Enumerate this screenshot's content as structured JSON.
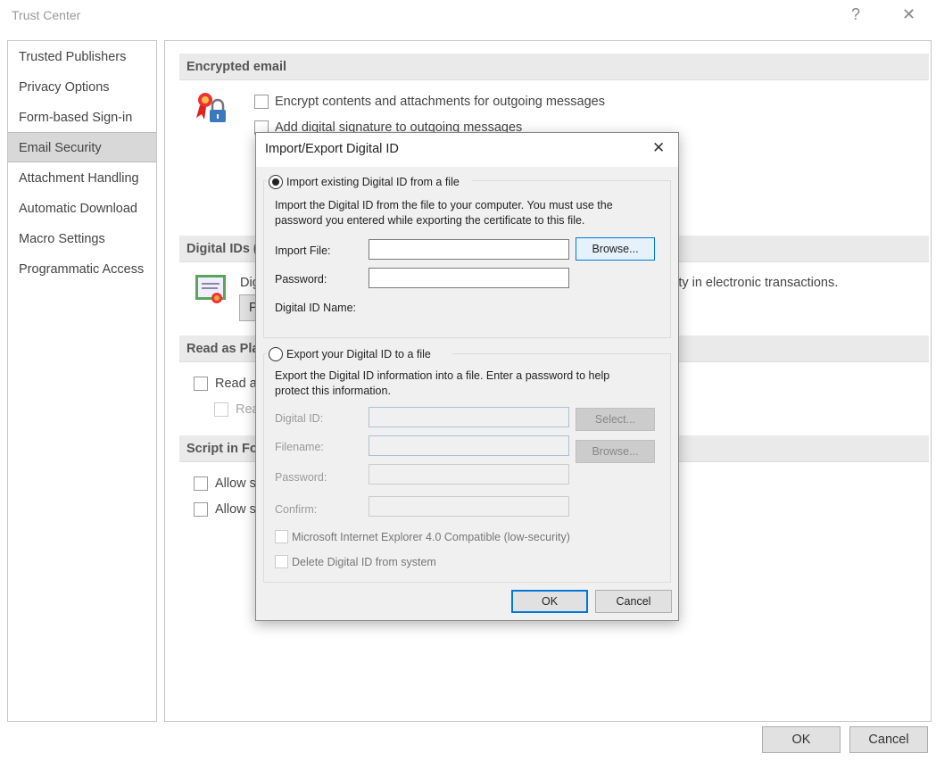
{
  "window": {
    "title": "Trust Center",
    "help_icon": "?",
    "close_icon": "✕"
  },
  "sidebar": {
    "items": [
      {
        "label": "Trusted Publishers"
      },
      {
        "label": "Privacy Options"
      },
      {
        "label": "Form-based Sign-in"
      },
      {
        "label": "Email Security",
        "selected": true
      },
      {
        "label": "Attachment Handling"
      },
      {
        "label": "Automatic Download"
      },
      {
        "label": "Macro Settings"
      },
      {
        "label": "Programmatic Access"
      }
    ]
  },
  "main": {
    "encrypted": {
      "header": "Encrypted email",
      "options": [
        "Encrypt contents and attachments for outgoing messages",
        "Add digital signature to outgoing messages"
      ]
    },
    "digital_ids": {
      "header": "Digital IDs (",
      "text_left": "Dig",
      "text_right": "ntity in electronic transactions.",
      "button_fragment": "P"
    },
    "read_plain": {
      "header": "Read as Pla",
      "options": [
        "Read a",
        "Rea"
      ]
    },
    "script": {
      "header": "Script in Fo",
      "options": [
        "Allow s",
        "Allow s"
      ]
    }
  },
  "footer": {
    "ok": "OK",
    "cancel": "Cancel"
  },
  "dialog": {
    "title": "Import/Export Digital ID",
    "close_icon": "✕",
    "import": {
      "radio_label": "Import existing Digital ID from a file",
      "selected": true,
      "description_line1": "Import the Digital ID from the file to your computer. You must use the",
      "description_line2": "password you entered while exporting the certificate to this file.",
      "import_file_label": "Import File:",
      "import_file_value": "",
      "browse": "Browse...",
      "password_label": "Password:",
      "password_value": "",
      "digital_id_name_label": "Digital ID Name:"
    },
    "export": {
      "radio_label": "Export your Digital ID to a file",
      "selected": false,
      "description_line1": "Export the Digital ID information into a file. Enter a password to help",
      "description_line2": "protect this information.",
      "digital_id_label": "Digital ID:",
      "select": "Select...",
      "filename_label": "Filename:",
      "browse": "Browse...",
      "password_label": "Password:",
      "confirm_label": "Confirm:",
      "ie_compat": "Microsoft Internet Explorer 4.0 Compatible (low-security)",
      "delete_id": "Delete Digital ID from system"
    },
    "ok": "OK",
    "cancel": "Cancel"
  },
  "colors": {
    "accent": "#0078d7",
    "selected_nav": "#d8d8d8",
    "section_header": "#eaeaea",
    "dialog_bg": "#f0f0f0"
  }
}
